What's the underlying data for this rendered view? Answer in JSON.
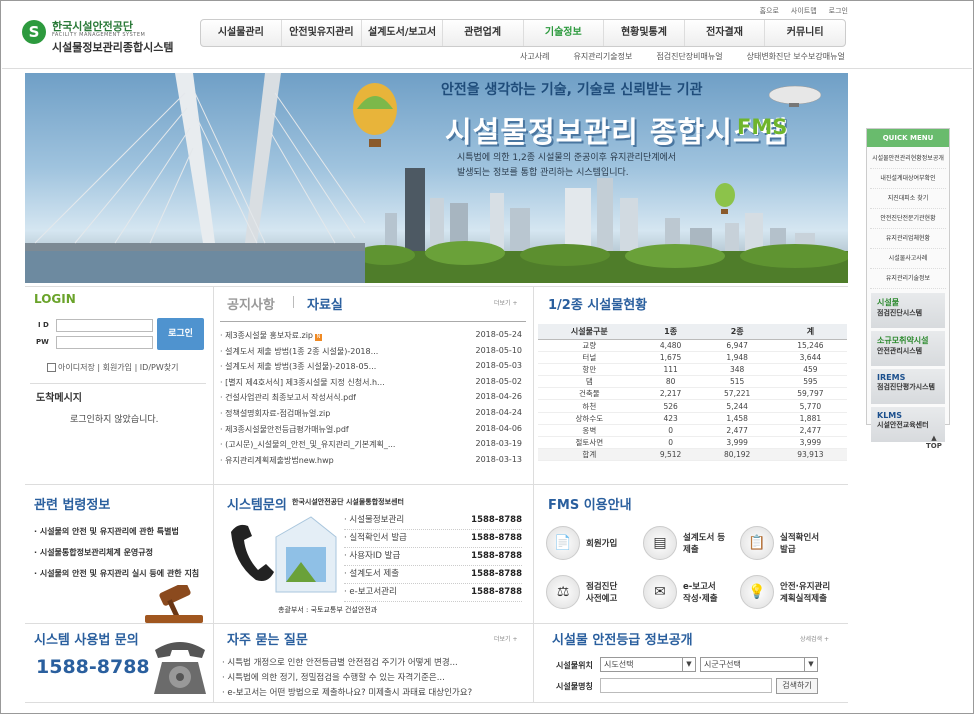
{
  "header": {
    "logo_top": "한국시설안전공단",
    "logo_sub": "FACILITY MANAGEMENT SYSTEM",
    "logo_name": "시설물정보관리종합시스템",
    "util": [
      "홈으로",
      "사이트맵",
      "로그인"
    ],
    "gnb": [
      "시설물관리",
      "안전및유지관리",
      "설계도서/보고서",
      "관련업계",
      "기술정보",
      "현황및통계",
      "전자결재",
      "커뮤니티"
    ],
    "subnav": [
      "사고사례",
      "유지관리기술정보",
      "점검진단장비매뉴얼",
      "상태변화진단 보수보강매뉴얼"
    ]
  },
  "banner": {
    "headline": "안전을 생각하는 기술, 기술로 신뢰받는 기관",
    "title": "시설물정보관리 종합시스템",
    "title_abbr": "FMS",
    "desc1": "시특법에 의한 1,2종 시설물의 준공이후 유지관리단계에서",
    "desc2": "발생되는 정보를 통합 관리하는 시스템입니다."
  },
  "quick_menu": {
    "title": "QUICK MENU",
    "items": [
      "시설물안전관리현황정보공개",
      "내진설계대상여부확인",
      "지진대피소 찾기",
      "안전진단전문기관현황",
      "유지관리업체현황",
      "시설물사고사례",
      "유지관리기술정보"
    ],
    "banners": [
      {
        "a": "시설물",
        "b": "점검진단시스템"
      },
      {
        "a": "소규모취약시설",
        "b": "안전관리시스템"
      },
      {
        "a": "IREMS",
        "b": "점검진단평가시스템"
      },
      {
        "a": "KLMS",
        "b": "시설안전교육센터"
      }
    ],
    "top": "TOP"
  },
  "login": {
    "title": "LOGIN",
    "id_label": "I D",
    "pw_label": "PW",
    "button": "로그인",
    "links": "아이디저장  |  회원가입  |  ID/PW찾기",
    "msg_title": "도착메시지",
    "msg_text": "로그인하지 않았습니다."
  },
  "notices": {
    "tab1": "공지사항",
    "tab2": "자료실",
    "more": "더보기 +",
    "items": [
      {
        "title": "제3종시설물 홍보자료.zip",
        "date": "2018-05-24",
        "new": "N"
      },
      {
        "title": "설계도서 제출 방법(1종 2종 시설물)-2018...",
        "date": "2018-05-10"
      },
      {
        "title": "설계도서 제출 방법(3종 시설물)-2018-05...",
        "date": "2018-05-03"
      },
      {
        "title": "[별지 제4호서식] 제3종시설물 지정 신청서.h...",
        "date": "2018-05-02"
      },
      {
        "title": "건설사업관리 최종보고서 작성서식.pdf",
        "date": "2018-04-26"
      },
      {
        "title": "정책설명회자료-점검매뉴얼.zip",
        "date": "2018-04-24"
      },
      {
        "title": "제3종시설물안전등급평가매뉴얼.pdf",
        "date": "2018-04-06"
      },
      {
        "title": "(고시문)_시설물의_안전_및_유지관리_기본계획_...",
        "date": "2018-03-19"
      },
      {
        "title": "유지관리계획제출방법new.hwp",
        "date": "2018-03-13"
      }
    ]
  },
  "stats": {
    "title": "1/2종 시설물현황",
    "headers": [
      "시설물구분",
      "1종",
      "2종",
      "계"
    ],
    "rows": [
      [
        "교량",
        "4,480",
        "6,947",
        "15,246"
      ],
      [
        "터널",
        "1,675",
        "1,948",
        "3,644"
      ],
      [
        "항만",
        "111",
        "348",
        "459"
      ],
      [
        "댐",
        "80",
        "515",
        "595"
      ],
      [
        "건축물",
        "2,217",
        "57,221",
        "59,797"
      ],
      [
        "하천",
        "526",
        "5,244",
        "5,770"
      ],
      [
        "상하수도",
        "423",
        "1,458",
        "1,881"
      ],
      [
        "옹벽",
        "0",
        "2,477",
        "2,477"
      ],
      [
        "절토사면",
        "0",
        "3,999",
        "3,999"
      ],
      [
        "합계",
        "9,512",
        "80,192",
        "93,913"
      ]
    ]
  },
  "law": {
    "title": "관련 법령정보",
    "items": [
      "시설물의 안전 및 유지관리에 관한 특별법",
      "시설물통합정보관리체계 운영규정",
      "시설물의 안전 및 유지관리 실시 등에 관한 지침"
    ]
  },
  "system": {
    "title": "시스템문의",
    "subtitle": "한국시설안전공단 시설물통합정보센터",
    "rows": [
      {
        "label": "시설물정보관리",
        "tel": "1588-8788"
      },
      {
        "label": "실적확인서 발급",
        "tel": "1588-8788"
      },
      {
        "label": "사용자ID 발급",
        "tel": "1588-8788"
      },
      {
        "label": "설계도서 제출",
        "tel": "1588-8788"
      },
      {
        "label": "e-보고서관리",
        "tel": "1588-8788"
      }
    ],
    "footer": "총괄부서 : 국토교통부 건설안전과"
  },
  "guide": {
    "title": "FMS 이용안내",
    "items": [
      {
        "l1": "회원가입",
        "l2": "",
        "icon": "📄"
      },
      {
        "l1": "설계도서 등",
        "l2": "제출",
        "icon": "▤"
      },
      {
        "l1": "실적확인서",
        "l2": "발급",
        "icon": "📋"
      },
      {
        "l1": "점검진단",
        "l2": "사전예고",
        "icon": "⚖"
      },
      {
        "l1": "e-보고서",
        "l2": "작성·제출",
        "icon": "✉"
      },
      {
        "l1": "안전·유지관리",
        "l2": "계획실적제출",
        "icon": "💡"
      }
    ]
  },
  "contact": {
    "title": "시스템 사용법 문의",
    "phone": "1588-8788"
  },
  "faq": {
    "title": "자주 묻는 질문",
    "more": "더보기 +",
    "items": [
      "시특법 개정으로 인한 안전등급별 안전점검 주기가 어떻게 변경...",
      "시특법에 의한 정기, 정밀점검을 수행할 수 있는 자격기준은...",
      "e-보고서는 어떤 방법으로 제출하나요? 미제출시 과태료 대상인가요?"
    ]
  },
  "grade": {
    "title": "시설물 안전등급 정보공개",
    "more": "상세검색 +",
    "loc_label": "시설물위치",
    "name_label": "시설물명칭",
    "sido": "시도선택",
    "sigungu": "시군구선택",
    "search": "검색하기"
  }
}
